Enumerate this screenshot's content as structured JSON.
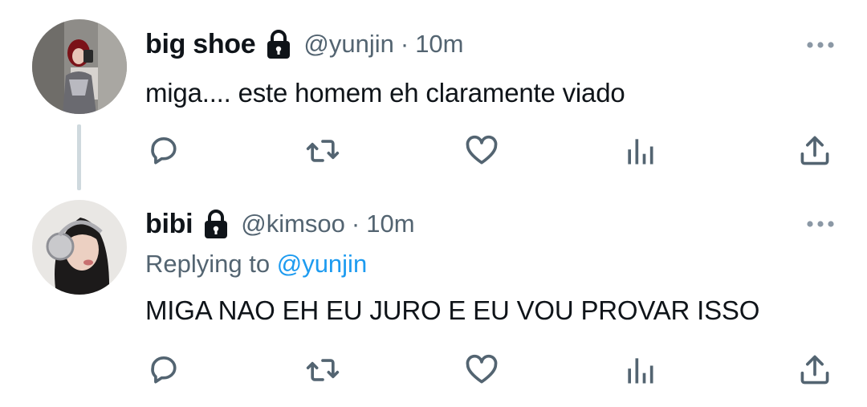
{
  "tweets": [
    {
      "display_name": "big shoe",
      "handle": "@yunjin",
      "separator": "·",
      "time": "10m",
      "text": "miga.... este homem eh claramente viado"
    },
    {
      "display_name": "bibi",
      "handle": "@kimsoo",
      "separator": "·",
      "time": "10m",
      "replying_prefix": "Replying to",
      "replying_handle": "@yunjin",
      "text": "MIGA NAO EH EU JURO E EU VOU PROVAR ISSO"
    }
  ],
  "icons": {
    "lock": "lock-icon",
    "more": "more-horizontal-icon",
    "reply": "reply-bubble-icon",
    "retweet": "retweet-icon",
    "like": "heart-icon",
    "views": "views-bar-chart-icon",
    "share": "share-upload-icon"
  },
  "colors": {
    "text": "#0f1419",
    "secondary": "#536471",
    "link": "#1d9bf0",
    "thread_line": "#cfd9de"
  }
}
